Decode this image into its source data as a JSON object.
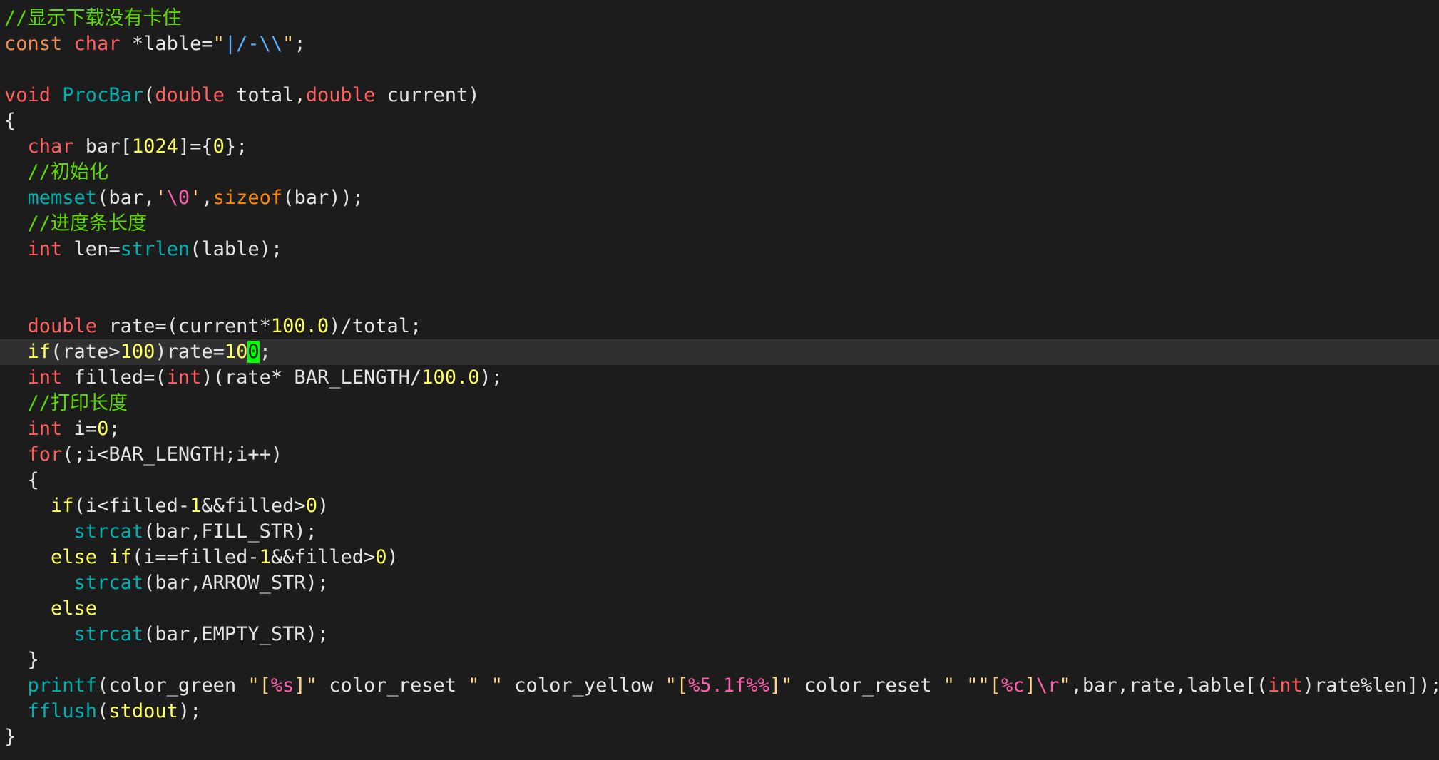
{
  "editor": {
    "colors": {
      "background": "#1c1c1c",
      "cursorline": "#303030",
      "comment": "#5fd700",
      "keyword": "#ef8d4f",
      "type": "#ff5f5f",
      "control": "#ffff5f",
      "function": "#00afaf",
      "operator": "#ff8700",
      "number": "#ffff5f",
      "string": "#ffd787",
      "escape": "#ff5faf",
      "special_char": "#5fafff",
      "text": "#e4e4e4",
      "cursor": "#00ff00"
    },
    "cursor": {
      "line": 14,
      "column": 16,
      "char": "0"
    },
    "lines": [
      [
        [
          "cm",
          "//显示下载没有卡住"
        ]
      ],
      [
        [
          "kw",
          "const"
        ],
        [
          "pl",
          " "
        ],
        [
          "ty",
          "char"
        ],
        [
          "pl",
          " *lable="
        ],
        [
          "str",
          "\""
        ],
        [
          "sq",
          "|/-\\\\"
        ],
        [
          "str",
          "\""
        ],
        [
          "pl",
          ";"
        ]
      ],
      [],
      [
        [
          "ty",
          "void"
        ],
        [
          "pl",
          " "
        ],
        [
          "fn",
          "ProcBar"
        ],
        [
          "pl",
          "("
        ],
        [
          "ty",
          "double"
        ],
        [
          "pl",
          " total,"
        ],
        [
          "ty",
          "double"
        ],
        [
          "pl",
          " current)"
        ]
      ],
      [
        [
          "pl",
          "{"
        ]
      ],
      [
        [
          "pl",
          "  "
        ],
        [
          "ty",
          "char"
        ],
        [
          "pl",
          " bar["
        ],
        [
          "num",
          "1024"
        ],
        [
          "pl",
          "]={"
        ],
        [
          "num",
          "0"
        ],
        [
          "pl",
          "};"
        ]
      ],
      [
        [
          "pl",
          "  "
        ],
        [
          "cm",
          "//初始化"
        ]
      ],
      [
        [
          "pl",
          "  "
        ],
        [
          "fn",
          "memset"
        ],
        [
          "pl",
          "(bar,"
        ],
        [
          "str",
          "'"
        ],
        [
          "esc",
          "\\0"
        ],
        [
          "str",
          "'"
        ],
        [
          "pl",
          ","
        ],
        [
          "op",
          "sizeof"
        ],
        [
          "pl",
          "(bar));"
        ]
      ],
      [
        [
          "pl",
          "  "
        ],
        [
          "cm",
          "//进度条长度"
        ]
      ],
      [
        [
          "pl",
          "  "
        ],
        [
          "ty",
          "int"
        ],
        [
          "pl",
          " len="
        ],
        [
          "fn",
          "strlen"
        ],
        [
          "pl",
          "(lable);"
        ]
      ],
      [],
      [],
      [
        [
          "pl",
          "  "
        ],
        [
          "ty",
          "double"
        ],
        [
          "pl",
          " rate=(current*"
        ],
        [
          "num",
          "100.0"
        ],
        [
          "pl",
          ")/total;"
        ]
      ],
      [
        [
          "pl",
          "  "
        ],
        [
          "ctl",
          "if"
        ],
        [
          "pl",
          "(rate>"
        ],
        [
          "num",
          "100"
        ],
        [
          "pl",
          ")rate="
        ],
        [
          "num",
          "10"
        ],
        [
          "cursor",
          "0"
        ],
        [
          "pl",
          ";"
        ]
      ],
      [
        [
          "pl",
          "  "
        ],
        [
          "ty",
          "int"
        ],
        [
          "pl",
          " filled=("
        ],
        [
          "ty",
          "int"
        ],
        [
          "pl",
          ")(rate* BAR_LENGTH/"
        ],
        [
          "num",
          "100.0"
        ],
        [
          "pl",
          ");"
        ]
      ],
      [
        [
          "pl",
          "  "
        ],
        [
          "cm",
          "//打印长度"
        ]
      ],
      [
        [
          "pl",
          "  "
        ],
        [
          "ty",
          "int"
        ],
        [
          "pl",
          " i="
        ],
        [
          "num",
          "0"
        ],
        [
          "pl",
          ";"
        ]
      ],
      [
        [
          "pl",
          "  "
        ],
        [
          "ty",
          "for"
        ],
        [
          "pl",
          "(;i<BAR_LENGTH;i++)"
        ]
      ],
      [
        [
          "pl",
          "  {"
        ]
      ],
      [
        [
          "pl",
          "    "
        ],
        [
          "ctl",
          "if"
        ],
        [
          "pl",
          "(i<filled-"
        ],
        [
          "num",
          "1"
        ],
        [
          "pl",
          "&&filled>"
        ],
        [
          "num",
          "0"
        ],
        [
          "pl",
          ")"
        ]
      ],
      [
        [
          "pl",
          "      "
        ],
        [
          "fn",
          "strcat"
        ],
        [
          "pl",
          "(bar,FILL_STR);"
        ]
      ],
      [
        [
          "pl",
          "    "
        ],
        [
          "ctl",
          "else"
        ],
        [
          "pl",
          " "
        ],
        [
          "ctl",
          "if"
        ],
        [
          "pl",
          "(i=="
        ],
        [
          "pl",
          "filled-"
        ],
        [
          "num",
          "1"
        ],
        [
          "pl",
          "&&filled>"
        ],
        [
          "num",
          "0"
        ],
        [
          "pl",
          ")"
        ]
      ],
      [
        [
          "pl",
          "      "
        ],
        [
          "fn",
          "strcat"
        ],
        [
          "pl",
          "(bar,ARROW_STR);"
        ]
      ],
      [
        [
          "pl",
          "    "
        ],
        [
          "ctl",
          "else"
        ]
      ],
      [
        [
          "pl",
          "      "
        ],
        [
          "fn",
          "strcat"
        ],
        [
          "pl",
          "(bar,EMPTY_STR);"
        ]
      ],
      [
        [
          "pl",
          "  }"
        ]
      ],
      [
        [
          "pl",
          "  "
        ],
        [
          "fn",
          "printf"
        ],
        [
          "pl",
          "(color_green "
        ],
        [
          "str",
          "\"["
        ],
        [
          "esc",
          "%s"
        ],
        [
          "str",
          "]\""
        ],
        [
          "pl",
          " color_reset "
        ],
        [
          "str",
          "\" \""
        ],
        [
          "pl",
          " color_yellow "
        ],
        [
          "str",
          "\"["
        ],
        [
          "esc",
          "%5.1f%%"
        ],
        [
          "str",
          "]\""
        ],
        [
          "pl",
          " color_reset "
        ],
        [
          "str",
          "\" \"\"["
        ],
        [
          "esc",
          "%c"
        ],
        [
          "str",
          "]"
        ],
        [
          "esc",
          "\\r"
        ],
        [
          "str",
          "\""
        ],
        [
          "pl",
          ",bar,rate,lable[("
        ],
        [
          "ty",
          "int"
        ],
        [
          "pl",
          ")rate%len]);"
        ]
      ],
      [
        [
          "pl",
          "  "
        ],
        [
          "fn",
          "fflush"
        ],
        [
          "pl",
          "("
        ],
        [
          "ctl",
          "stdout"
        ],
        [
          "pl",
          ");"
        ]
      ],
      [
        [
          "pl",
          "}"
        ]
      ]
    ]
  }
}
